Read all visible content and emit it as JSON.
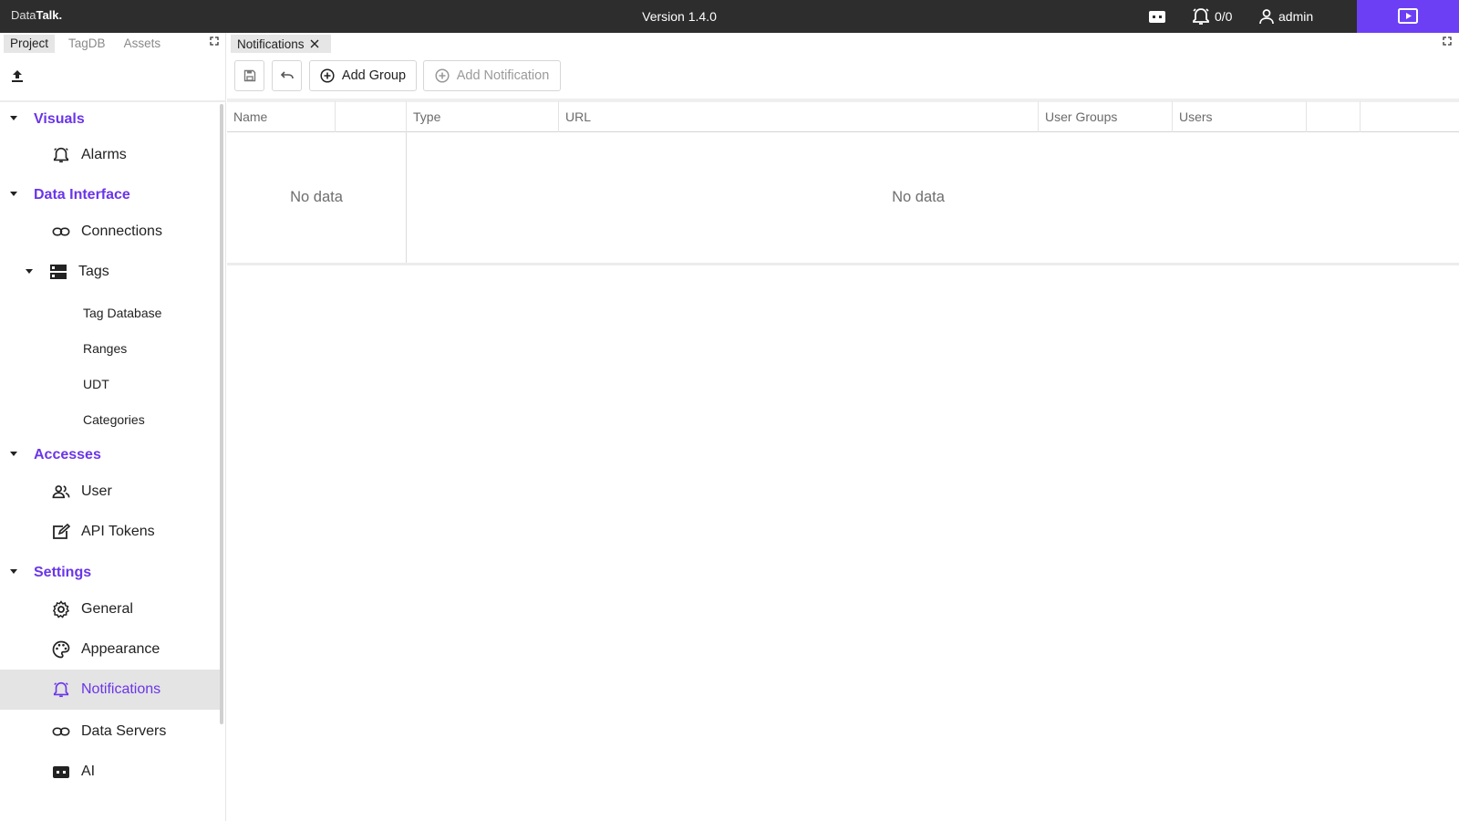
{
  "app": {
    "logo_light": "Data",
    "logo_bold": "Talk.",
    "version": "Version 1.4.0",
    "alarm_count": "0/0",
    "user": "admin",
    "accent_color": "#6c3ff5"
  },
  "left_tabs": [
    "Project",
    "TagDB",
    "Assets"
  ],
  "nav": {
    "visuals": {
      "label": "Visuals",
      "items": [
        {
          "label": "Alarms",
          "icon": "alarm-bell-icon"
        }
      ]
    },
    "data_interface": {
      "label": "Data Interface",
      "connections": "Connections",
      "tags": "Tags",
      "tag_subitems": [
        "Tag Database",
        "Ranges",
        "UDT",
        "Categories"
      ]
    },
    "accesses": {
      "label": "Accesses",
      "items": [
        {
          "label": "User",
          "icon": "users-icon"
        },
        {
          "label": "API Tokens",
          "icon": "token-edit-icon"
        }
      ]
    },
    "settings": {
      "label": "Settings",
      "items": [
        {
          "label": "General",
          "icon": "gear-icon"
        },
        {
          "label": "Appearance",
          "icon": "palette-icon"
        },
        {
          "label": "Notifications",
          "icon": "alarm-bell-icon"
        },
        {
          "label": "Data Servers",
          "icon": "link-icon"
        },
        {
          "label": "AI",
          "icon": "robot-icon"
        }
      ]
    }
  },
  "main": {
    "tab_label": "Notifications",
    "toolbar": {
      "add_group": "Add Group",
      "add_notification": "Add Notification"
    },
    "left_table": {
      "header": "Name",
      "empty_text": "No data"
    },
    "right_table": {
      "headers": [
        "Type",
        "URL",
        "User Groups",
        "Users"
      ],
      "empty_text": "No data"
    }
  }
}
